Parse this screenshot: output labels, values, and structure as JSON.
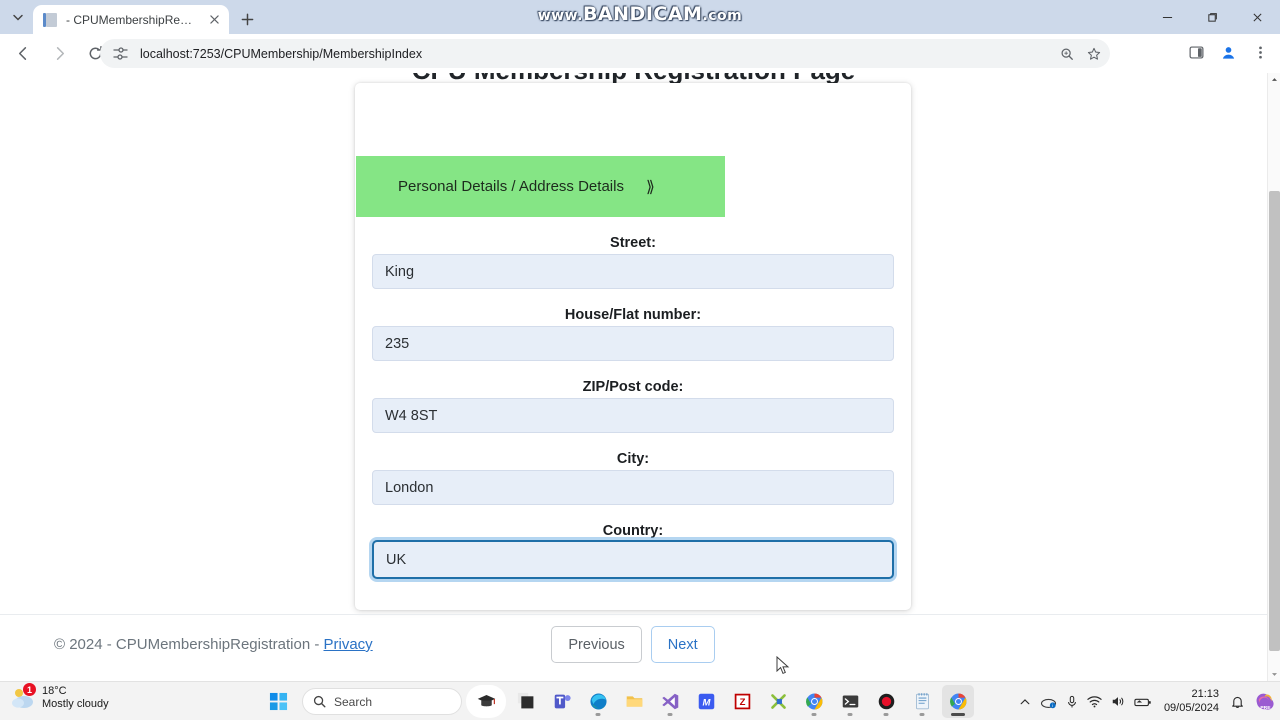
{
  "browser": {
    "tab": {
      "title": "- CPUMembershipRegistration",
      "favicon": "document-icon",
      "close": "close-icon"
    },
    "new_tab_label": "+",
    "tab_list_icon": "chevron-down-icon",
    "watermark_main": "BANDICAM",
    "watermark_prefix": "www.",
    "watermark_suffix": ".com",
    "nav": {
      "back": "back-arrow-icon",
      "forward": "forward-arrow-icon",
      "reload": "reload-icon"
    },
    "omnibox": {
      "url": "localhost:7253/CPUMembership/MembershipIndex",
      "site_icon": "site-settings-icon",
      "zoom_icon": "search-zoom-icon",
      "bookmark_icon": "star-icon"
    },
    "toolbar_right": {
      "side_panel": "side-panel-icon",
      "profile": "profile-avatar-icon",
      "menu": "three-dot-menu-icon"
    },
    "window": {
      "minimize": "minimize-icon",
      "maximize": "maximize-icon",
      "close": "close-icon"
    }
  },
  "page": {
    "heading": "CPU Membership Registration Page",
    "wizard": {
      "step_previous": "Personal Details",
      "separator": "/",
      "step_current": "Address Details",
      "chevron": "⟫"
    },
    "fields": [
      {
        "label": "Street:",
        "value": "King",
        "focused": false,
        "name": "street"
      },
      {
        "label": "House/Flat number:",
        "value": "235",
        "focused": false,
        "name": "house-flat-number"
      },
      {
        "label": "ZIP/Post code:",
        "value": "W4 8ST",
        "focused": false,
        "name": "zip-post-code"
      },
      {
        "label": "City:",
        "value": "London",
        "focused": false,
        "name": "city"
      },
      {
        "label": "Country:",
        "value": "UK",
        "focused": true,
        "name": "country"
      }
    ],
    "buttons": {
      "previous": "Previous",
      "next": "Next"
    },
    "footer": {
      "copyright": "© 2024 - CPUMembershipRegistration - ",
      "privacy_link": "Privacy"
    },
    "colors": {
      "wizard_header": "#85e585",
      "input_fill": "#e7eef8",
      "focus_border": "#1f6fa8",
      "next_text": "#2a72c5"
    }
  },
  "taskbar": {
    "weather": {
      "temperature": "18°C",
      "description": "Mostly cloudy",
      "badge": "1",
      "icon": "weather-cloud-icon"
    },
    "start_icon": "windows-start-icon",
    "search_placeholder": "Search",
    "search_icon": "search-icon",
    "apps": [
      {
        "name": "graduation-cap-app",
        "glyph": "🎓",
        "active": false,
        "running": false
      },
      {
        "name": "task-view",
        "glyph": "",
        "active": false,
        "running": false
      },
      {
        "name": "microsoft-teams",
        "glyph": "T",
        "active": false,
        "running": false
      },
      {
        "name": "microsoft-edge",
        "glyph": "",
        "active": false,
        "running": true
      },
      {
        "name": "file-explorer",
        "glyph": "",
        "active": false,
        "running": false
      },
      {
        "name": "visual-studio",
        "glyph": "",
        "active": false,
        "running": true
      },
      {
        "name": "blue-m-app",
        "glyph": "M",
        "active": false,
        "running": false
      },
      {
        "name": "filezilla",
        "glyph": "FZ",
        "active": false,
        "running": false
      },
      {
        "name": "green-x-app",
        "glyph": "",
        "active": false,
        "running": false
      },
      {
        "name": "google-chrome",
        "glyph": "",
        "active": false,
        "running": true
      },
      {
        "name": "terminal",
        "glyph": ">_",
        "active": false,
        "running": true
      },
      {
        "name": "bandicam-recorder",
        "glyph": "",
        "active": false,
        "running": true
      },
      {
        "name": "notepad",
        "glyph": "",
        "active": false,
        "running": true
      },
      {
        "name": "google-chrome-window",
        "glyph": "",
        "active": true,
        "running": true
      }
    ],
    "tray": {
      "overflow": "chevron-up-icon",
      "onedrive": "onedrive-icon",
      "microphone": "microphone-icon",
      "wifi": "wifi-icon",
      "volume": "volume-icon",
      "battery": "battery-icon",
      "notifications": "bell-icon",
      "copilot": "copilot-icon",
      "time": "21:13",
      "date": "09/05/2024"
    }
  }
}
